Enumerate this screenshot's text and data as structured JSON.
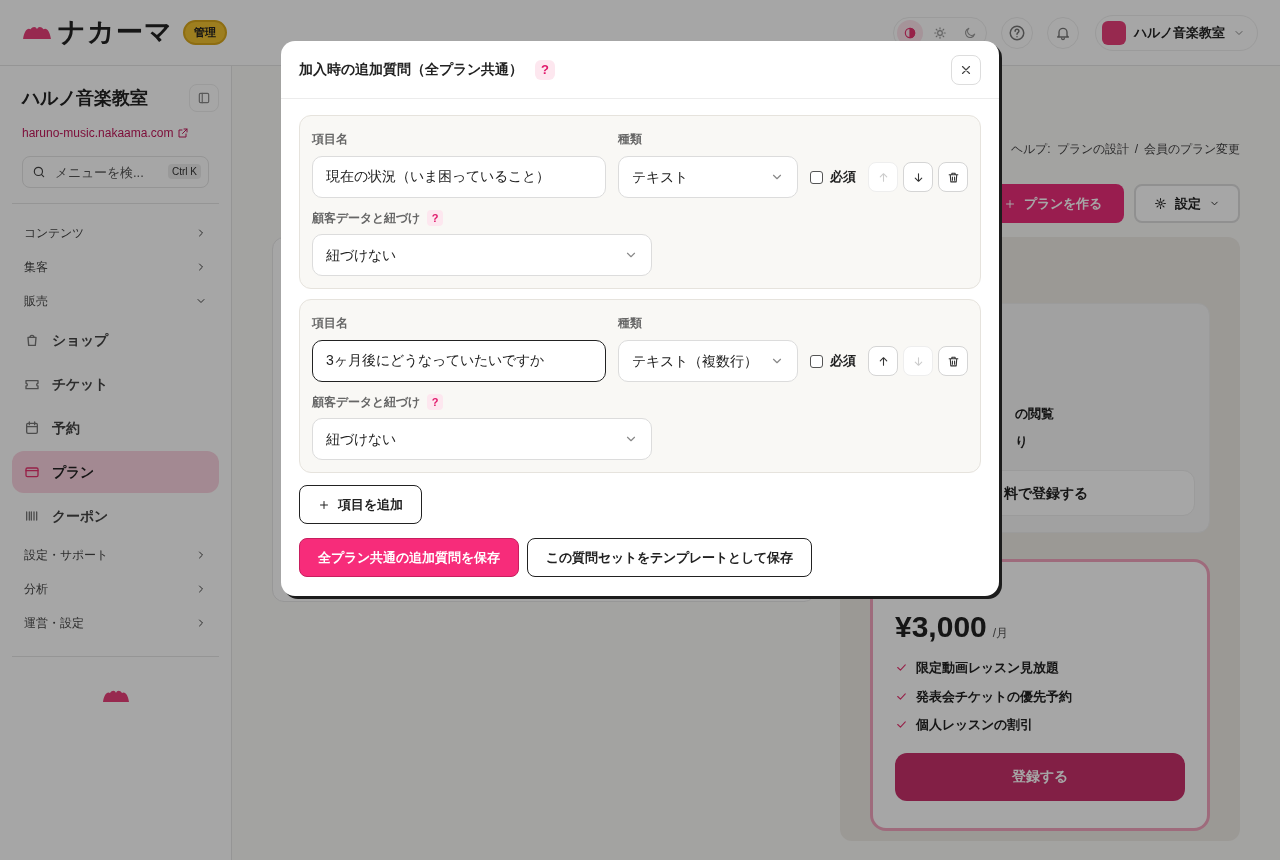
{
  "header": {
    "logo_text": "ナカーマ",
    "badge": "管理",
    "theme_options": [
      {
        "selected": true
      },
      {
        "selected": false
      },
      {
        "selected": false
      }
    ],
    "account_name": "ハルノ音楽教室"
  },
  "sidebar": {
    "title": "ハルノ音楽教室",
    "site_link": "haruno-music.nakaama.com",
    "search": {
      "placeholder": "メニューを検...",
      "shortcut": "Ctrl K"
    },
    "items": [
      {
        "kind": "section",
        "label": "コンテンツ",
        "expanded": false
      },
      {
        "kind": "section",
        "label": "集客",
        "expanded": false
      },
      {
        "kind": "section",
        "label": "販売",
        "expanded": true
      },
      {
        "kind": "item",
        "label": "ショップ",
        "selected": false
      },
      {
        "kind": "item",
        "label": "チケット",
        "selected": false
      },
      {
        "kind": "item",
        "label": "予約",
        "selected": false
      },
      {
        "kind": "item",
        "label": "プラン",
        "selected": true
      },
      {
        "kind": "item",
        "label": "クーポン",
        "selected": false
      },
      {
        "kind": "section",
        "label": "設定・サポート",
        "expanded": false
      },
      {
        "kind": "section",
        "label": "分析",
        "expanded": false
      },
      {
        "kind": "section",
        "label": "運営・設定",
        "expanded": false
      }
    ]
  },
  "main": {
    "help_label": "ヘルプ:",
    "help_links": [
      "プランの設計",
      "会員のプラン変更"
    ],
    "separator": "/",
    "create_button": "プランを作る",
    "settings_button": "設定",
    "plans": [
      {
        "kind": "free",
        "features": [
          "の閲覧",
          "り"
        ],
        "button": "料で登録する"
      },
      {
        "kind": "paid",
        "price": "¥3,000",
        "unit": "/月",
        "features": [
          "限定動画レッスン見放題",
          "発表会チケットの優先予約",
          "個人レッスンの割引"
        ],
        "button": "登録する"
      }
    ]
  },
  "modal": {
    "title": "加入時の追加質問（全プラン共通）",
    "help": "?",
    "questions": [
      {
        "name_label": "項目名",
        "name_value": "現在の状況（いま困っていること）",
        "focused": false,
        "type_label": "種類",
        "type_value": "テキスト",
        "required_label": "必須",
        "required": false,
        "can_move_up": false,
        "can_move_down": true,
        "link_label": "顧客データと紐づけ",
        "link_help": "?",
        "link_value": "紐づけない"
      },
      {
        "name_label": "項目名",
        "name_value": "3ヶ月後にどうなっていたいですか",
        "focused": true,
        "type_label": "種類",
        "type_value": "テキスト（複数行）",
        "required_label": "必須",
        "required": false,
        "can_move_up": true,
        "can_move_down": false,
        "link_label": "顧客データと紐づけ",
        "link_help": "?",
        "link_value": "紐づけない"
      }
    ],
    "add_button": "項目を追加",
    "save_button": "全プラン共通の追加質問を保存",
    "template_button": "この質問セットをテンプレートとして保存"
  }
}
